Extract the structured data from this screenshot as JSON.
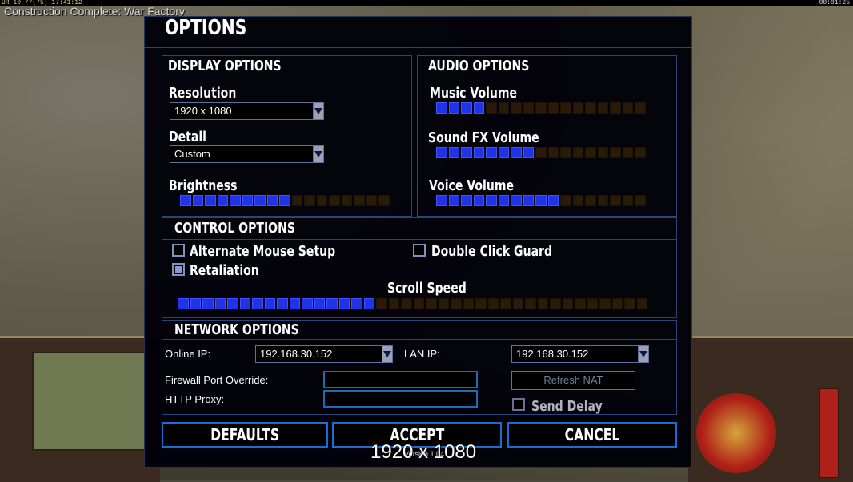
{
  "hud": {
    "system_info": "UR 10 77(75) 17:41:12",
    "clock": "00:01:25",
    "notice": "Construction Complete: War Factory"
  },
  "dialog": {
    "title": "OPTIONS",
    "display": {
      "heading": "DISPLAY OPTIONS",
      "resolution_label": "Resolution",
      "resolution_value": "1920 x 1080",
      "detail_label": "Detail",
      "detail_value": "Custom",
      "brightness_label": "Brightness",
      "brightness_level": 9,
      "brightness_max": 17
    },
    "audio": {
      "heading": "AUDIO OPTIONS",
      "music_label": "Music Volume",
      "music_level": 4,
      "music_max": 17,
      "sfx_label": "Sound FX Volume",
      "sfx_level": 8,
      "sfx_max": 17,
      "voice_label": "Voice Volume",
      "voice_level": 10,
      "voice_max": 17
    },
    "control": {
      "heading": "CONTROL OPTIONS",
      "alt_mouse_label": "Alternate Mouse Setup",
      "alt_mouse_checked": false,
      "double_click_label": "Double Click Guard",
      "double_click_checked": false,
      "retaliation_label": "Retaliation",
      "retaliation_checked": true,
      "scroll_label": "Scroll Speed",
      "scroll_level": 16,
      "scroll_max": 38
    },
    "network": {
      "heading": "NETWORK OPTIONS",
      "online_ip_label": "Online IP:",
      "online_ip_value": "192.168.30.152",
      "lan_ip_label": "LAN IP:",
      "lan_ip_value": "192.168.30.152",
      "firewall_label": "Firewall Port Override:",
      "firewall_value": "",
      "proxy_label": "HTTP Proxy:",
      "proxy_value": "",
      "refresh_nat_label": "Refresh NAT",
      "send_delay_label": "Send Delay",
      "send_delay_checked": false
    },
    "buttons": {
      "defaults": "DEFAULTS",
      "accept": "ACCEPT",
      "cancel": "CANCEL"
    },
    "version": "Version 1.04"
  },
  "resolution_overlay": "1920 x 1080",
  "colors": {
    "slider_on": "#1f34e8",
    "slider_off": "#2a1a08",
    "panel_border": "#2c4478",
    "button_border": "#1a6cd8"
  }
}
